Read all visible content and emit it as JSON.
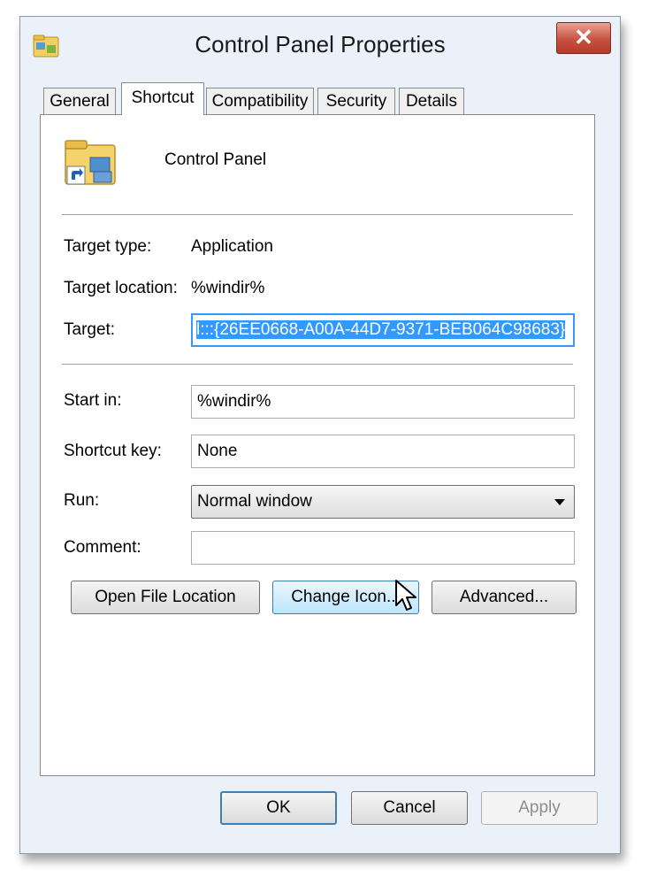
{
  "window": {
    "title": "Control Panel Properties",
    "close_label": "✕"
  },
  "tabs": [
    {
      "label": "General"
    },
    {
      "label": "Shortcut"
    },
    {
      "label": "Compatibility"
    },
    {
      "label": "Security"
    },
    {
      "label": "Details"
    }
  ],
  "active_tab": "Shortcut",
  "shortcut": {
    "name": "Control Panel",
    "target_type_label": "Target type:",
    "target_type_value": "Application",
    "target_location_label": "Target location:",
    "target_location_value": "%windir%",
    "target_label": "Target:",
    "target_value": "l:::{26EE0668-A00A-44D7-9371-BEB064C98683}",
    "start_in_label": "Start in:",
    "start_in_value": "%windir%",
    "shortcut_key_label": "Shortcut key:",
    "shortcut_key_value": "None",
    "run_label": "Run:",
    "run_value": "Normal window",
    "comment_label": "Comment:",
    "comment_value": ""
  },
  "buttons": {
    "open_file_location": "Open File Location",
    "change_icon": "Change Icon...",
    "advanced": "Advanced...",
    "ok": "OK",
    "cancel": "Cancel",
    "apply": "Apply"
  },
  "icons": {
    "app": "control-panel-shortcut-icon",
    "cursor": "mouse-pointer-icon"
  },
  "colors": {
    "selection": "#3399ff",
    "close_button": "#c75140",
    "hover_button": "#bee6fd"
  }
}
